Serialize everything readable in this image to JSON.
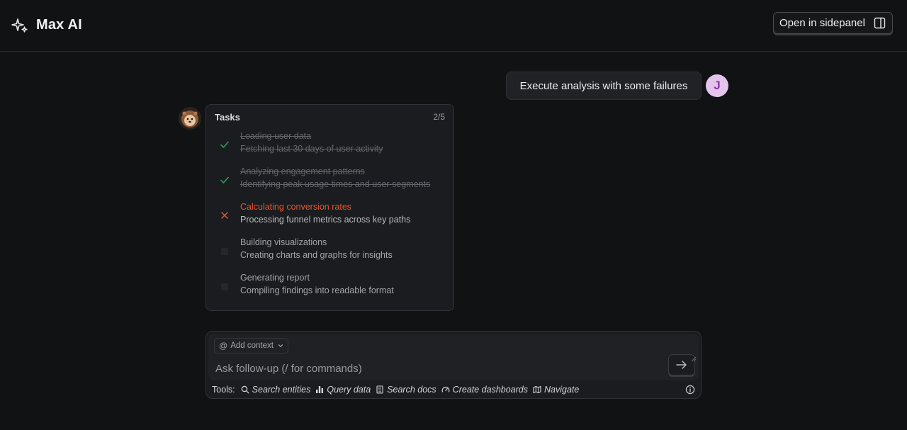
{
  "header": {
    "title": "Max AI",
    "sidepanel_button": "Open in sidepanel"
  },
  "conversation": {
    "user_message": "Execute analysis with some failures",
    "user_initial": "J"
  },
  "tasks": {
    "title": "Tasks",
    "count": "2/5",
    "items": [
      {
        "title": "Loading user data",
        "subtitle": "Fetching last 30 days of user activity",
        "status": "completed"
      },
      {
        "title": "Analyzing engagement patterns",
        "subtitle": "Identifying peak usage times and user segments",
        "status": "completed"
      },
      {
        "title": "Calculating conversion rates",
        "subtitle": "Processing funnel metrics across key paths",
        "status": "failed"
      },
      {
        "title": "Building visualizations",
        "subtitle": "Creating charts and graphs for insights",
        "status": "pending"
      },
      {
        "title": "Generating report",
        "subtitle": "Compiling findings into readable format",
        "status": "pending"
      }
    ]
  },
  "composer": {
    "add_context": "Add context",
    "placeholder": "Ask follow-up (/ for commands)",
    "tools_label": "Tools:",
    "tools": [
      {
        "label": "Search entities",
        "icon": "search-icon"
      },
      {
        "label": "Query data",
        "icon": "bar-chart-icon"
      },
      {
        "label": "Search docs",
        "icon": "book-icon"
      },
      {
        "label": "Create dashboards",
        "icon": "dashboard-icon"
      },
      {
        "label": "Navigate",
        "icon": "map-icon"
      }
    ]
  },
  "colors": {
    "accent_failed": "#e0552e",
    "accent_done": "#2e9a5a",
    "avatar_bg": "#e4c4ec"
  }
}
